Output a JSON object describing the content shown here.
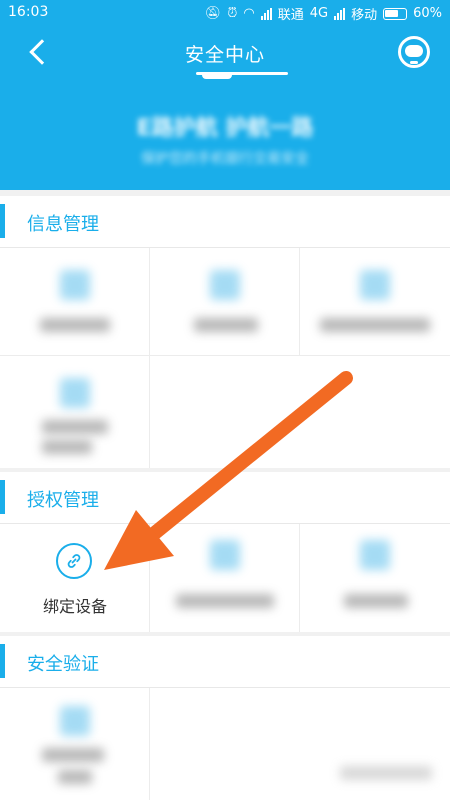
{
  "status_bar": {
    "time": "16:03",
    "carrier1": "联通",
    "network": "4G",
    "carrier2": "移动",
    "battery": "60%"
  },
  "header": {
    "title": "安全中心",
    "back_icon": "back-arrow-icon",
    "service_icon": "customer-service-icon",
    "banner_title": "E路护航 护航一路",
    "banner_subtitle": "保护您的手机银行交易安全"
  },
  "sections": [
    {
      "title": "信息管理"
    },
    {
      "title": "授权管理"
    },
    {
      "title": "安全验证"
    }
  ],
  "auth": {
    "bind_device_label": "绑定设备",
    "bind_device_icon": "link-icon"
  },
  "colors": {
    "accent": "#1aaeea",
    "annotation_arrow": "#f26a23"
  }
}
